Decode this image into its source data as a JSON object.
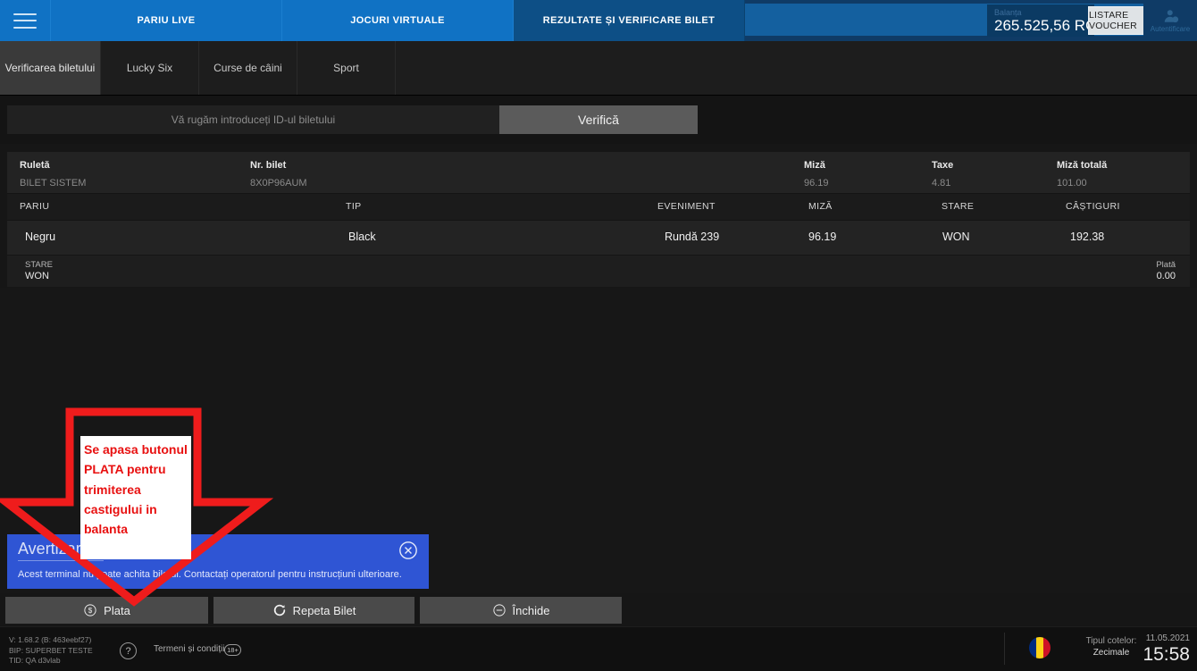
{
  "header": {
    "menu_icon": "hamburger-icon",
    "nav": [
      {
        "label": "PARIU LIVE",
        "active": false
      },
      {
        "label": "JOCURI VIRTUALE",
        "active": false
      },
      {
        "label": "REZULTATE ȘI VERIFICARE BILET",
        "active": true
      }
    ],
    "balance_label": "Balanța",
    "balance_value": "265.525,56 RON",
    "voucher_button": "LISTARE VOUCHER",
    "auth_label": "Autentificare",
    "auth_icon": "user-account-icon",
    "accent_color": "#1072c4",
    "active_nav_color": "#0d4f86"
  },
  "tabs": [
    {
      "label": "Verificarea biletului",
      "active": true
    },
    {
      "label": "Lucky Six",
      "active": false
    },
    {
      "label": "Curse de câini",
      "active": false
    },
    {
      "label": "Sport",
      "active": false
    }
  ],
  "search": {
    "placeholder": "Vă rugăm introduceți ID-ul biletului",
    "value": "",
    "verify_button": "Verifică"
  },
  "ticket": {
    "summary_headers": {
      "game": "Ruletă",
      "ticket_no": "Nr. bilet",
      "stake": "Miză",
      "tax": "Taxe",
      "total_stake": "Miză totală"
    },
    "summary_values": {
      "game": "BILET SISTEM",
      "ticket_no": "8X0P96AUM",
      "stake": "96.19",
      "tax": "4.81",
      "total_stake": "101.00"
    },
    "bet_columns": [
      "PARIU",
      "TIP",
      "EVENIMENT",
      "MIZĂ",
      "STARE",
      "CÂȘTIGURI"
    ],
    "bet_rows": [
      {
        "pariu": "Negru",
        "tip": "Black",
        "eveniment": "Rundă 239",
        "miza": "96.19",
        "stare": "WON",
        "castiguri": "192.38"
      }
    ],
    "status_label": "STARE",
    "status_value": "WON",
    "payout_label": "Plată",
    "payout_value": "0.00"
  },
  "warning": {
    "title": "Avertizare",
    "message": "Acest terminal nu poate achita biletul. Contactați operatorul pentru instrucțiuni ulterioare.",
    "close_icon": "close-circle-icon",
    "color": "#2f55d4"
  },
  "actions": [
    {
      "label": "Plata",
      "icon": "dollar-circle-icon"
    },
    {
      "label": "Repeta Bilet",
      "icon": "refresh-icon"
    },
    {
      "label": "Închide",
      "icon": "minus-circle-icon"
    }
  ],
  "footer": {
    "version_lines": "V: 1.68.2 (B: 463eebf27)\nBIP: SUPERBET TESTE\nTID: QA d3vlab",
    "help_icon": "question-mark-icon",
    "terms": "Termeni și condiții",
    "age_badge": "18+",
    "flag_icon": "romania-flag-icon",
    "odds_label": "Tipul cotelor:",
    "odds_value": "Zecimale",
    "date": "11.05.2021",
    "time": "15:58"
  },
  "annotation": {
    "text": "Se apasa butonul PLATA pentru trimiterea castigului in balanta",
    "arrow_icon": "down-arrow-annotation",
    "color": "#e81010"
  }
}
